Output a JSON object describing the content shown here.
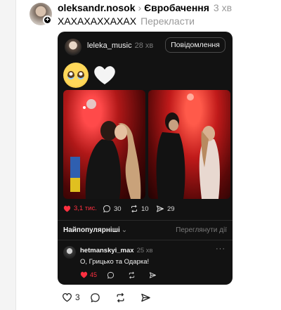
{
  "post": {
    "username": "oleksandr.nosok",
    "topic": "Євробачення",
    "time": "3 хв",
    "text": "ХАХАХАХХАХАХ",
    "translate_label": "Перекласти"
  },
  "quoted": {
    "username": "leleka_music",
    "time": "28 хв",
    "message_button": "Повідомлення",
    "emoji_icons": [
      "pleading-face-emoji",
      "white-heart-emoji"
    ],
    "stats": {
      "likes": "3,1 тис.",
      "comments": "30",
      "reposts": "10",
      "shares": "29"
    },
    "sort_label": "Найпопулярніші",
    "view_all_label": "Переглянути дії",
    "comment": {
      "username": "hetmanskyi_max",
      "time": "25 хв",
      "text": "О, Грицько та Одарка!",
      "likes": "45"
    }
  },
  "actions": {
    "likes": "3"
  },
  "colors": {
    "like_red": "#ff3040",
    "card_bg": "#121212",
    "muted": "#999999"
  }
}
